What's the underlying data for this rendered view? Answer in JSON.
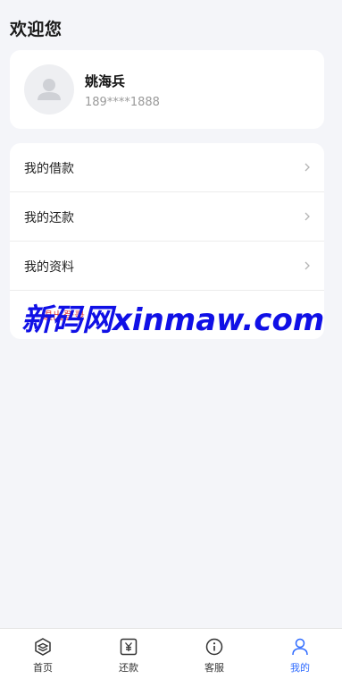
{
  "header": {
    "greeting": "欢迎您"
  },
  "profile": {
    "name": "姚海兵",
    "phone": "189****1888",
    "avatar_icon": "user-placeholder-icon"
  },
  "menu": {
    "items": [
      {
        "label": "我的借款",
        "icon": "chevron-right-icon"
      },
      {
        "label": "我的还款",
        "icon": "chevron-right-icon"
      },
      {
        "label": "我的资料",
        "icon": "chevron-right-icon"
      }
    ],
    "logout_label": "退出登录"
  },
  "watermark": {
    "text": "新码网xinmaw.com"
  },
  "tabbar": {
    "active_color": "#2f6bff",
    "items": [
      {
        "label": "首页",
        "icon": "home-cube-icon"
      },
      {
        "label": "还款",
        "icon": "yen-repay-icon"
      },
      {
        "label": "客服",
        "icon": "info-service-icon"
      },
      {
        "label": "我的",
        "icon": "profile-person-icon",
        "active": true
      }
    ]
  }
}
